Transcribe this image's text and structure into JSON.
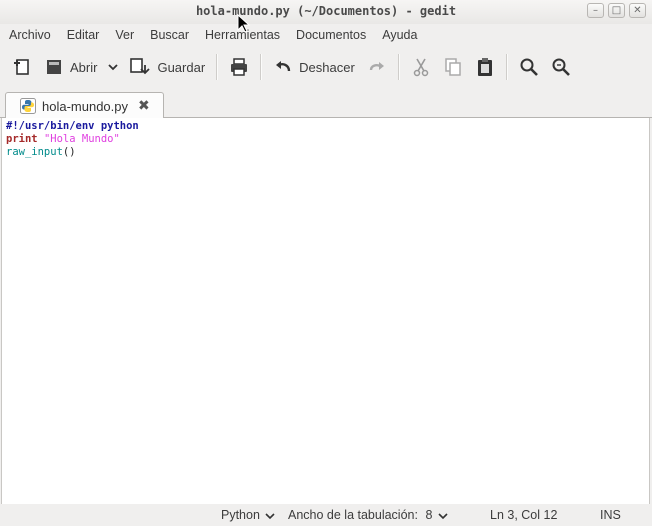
{
  "window": {
    "title": "hola-mundo.py (~/Documentos) - gedit",
    "controls": {
      "minimize": "–",
      "maximize": "□",
      "close": "✕"
    }
  },
  "menubar": [
    "Archivo",
    "Editar",
    "Ver",
    "Buscar",
    "Herramientas",
    "Documentos",
    "Ayuda"
  ],
  "toolbar": {
    "open_label": "Abrir",
    "save_label": "Guardar",
    "undo_label": "Deshacer"
  },
  "tab": {
    "label": "hola-mundo.py",
    "close": "✖"
  },
  "editor": {
    "line1": "#!/usr/bin/env python",
    "line2_kw": "print",
    "line2_str": "\"Hola Mundo\"",
    "line3_fn": "raw_input",
    "line3_rest": "()"
  },
  "statusbar": {
    "language": "Python",
    "tab_width_label": "Ancho de la tabulación:",
    "tab_width_value": "8",
    "position": "Ln 3, Col 12",
    "mode": "INS"
  },
  "colors": {
    "keyword": "#a52a2a",
    "string": "#e040e0",
    "shebang": "#1a1a9e",
    "builtin": "#008b8b"
  }
}
